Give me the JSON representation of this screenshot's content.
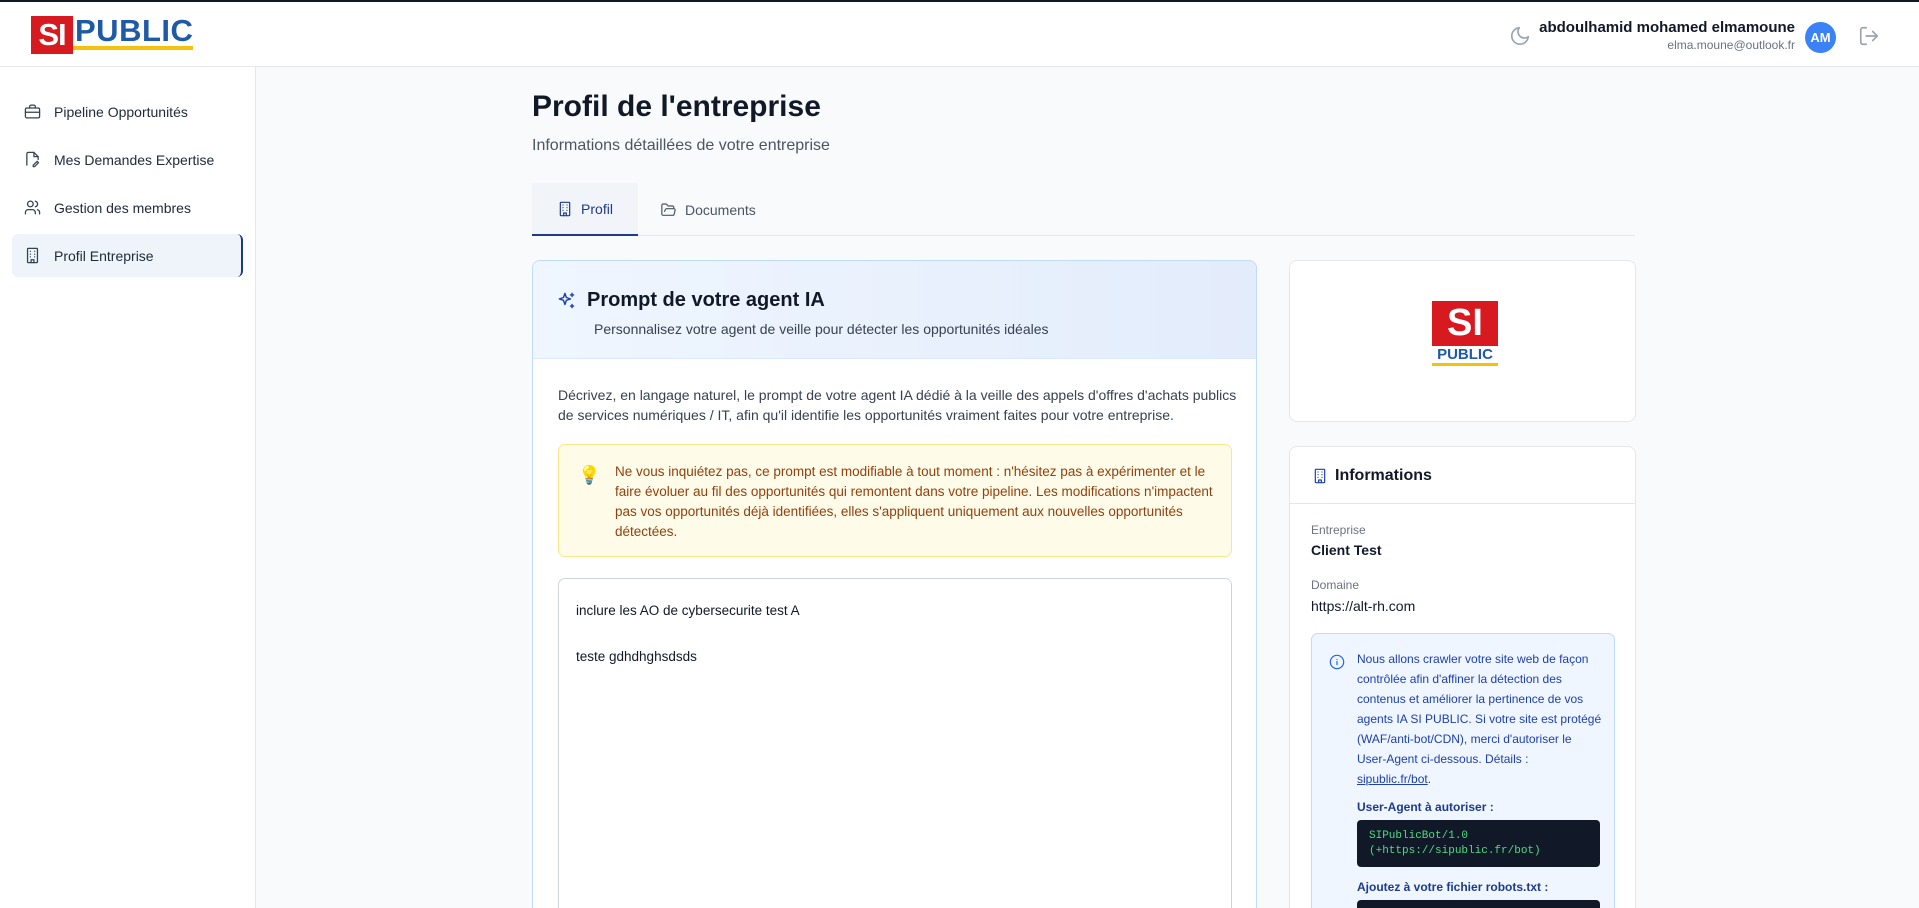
{
  "header": {
    "logo_si": "SI",
    "logo_public": "PUBLIC",
    "user_name": "abdoulhamid mohamed elmamoune",
    "user_email": "elma.moune@outlook.fr",
    "avatar_initials": "AM",
    "icons": [
      "moon-icon",
      "logout-icon"
    ]
  },
  "sidebar": {
    "items": [
      {
        "label": "Pipeline Opportunités",
        "icon": "briefcase-icon",
        "active": false
      },
      {
        "label": "Mes Demandes Expertise",
        "icon": "file-edit-icon",
        "active": false
      },
      {
        "label": "Gestion des membres",
        "icon": "users-icon",
        "active": false
      },
      {
        "label": "Profil Entreprise",
        "icon": "building-icon",
        "active": true
      }
    ]
  },
  "page": {
    "title": "Profil de l'entreprise",
    "subtitle": "Informations détaillées de votre entreprise"
  },
  "tabs": [
    {
      "label": "Profil",
      "icon": "building-icon",
      "active": true
    },
    {
      "label": "Documents",
      "icon": "folder-open-icon",
      "active": false
    }
  ],
  "prompt": {
    "title": "Prompt de votre agent IA",
    "subtitle": "Personnalisez votre agent de veille pour détecter les opportunités idéales",
    "description": "Décrivez, en langage naturel, le prompt de votre agent IA dédié à la veille des appels d'offres d'achats publics de services numériques / IT, afin qu'il identifie les opportunités vraiment faites pour votre entreprise.",
    "tip": "Ne vous inquiétez pas, ce prompt est modifiable à tout moment : n'hésitez pas à expérimenter et le faire évoluer au fil des opportunités qui remontent dans votre pipeline. Les modifications n'impactent pas vos opportunités déjà identifiées, elles s'appliquent uniquement aux nouvelles opportunités détectées.",
    "value": "inclure les AO de cybersecurite test A\n\nteste gdhdhghsdsds"
  },
  "company_logo": {
    "si": "SI",
    "public": "PUBLIC"
  },
  "info": {
    "title": "Informations",
    "entreprise_label": "Entreprise",
    "entreprise_value": "Client Test",
    "domaine_label": "Domaine",
    "domaine_value": "https://alt-rh.com",
    "crawl_text": "Nous allons crawler votre site web de façon contrôlée afin d'affiner la détection des contenus et améliorer la pertinence de vos agents IA SI PUBLIC. Si votre site est protégé (WAF/anti-bot/CDN), merci d'autoriser le User-Agent ci-dessous. Détails : ",
    "crawl_link": "sipublic.fr/bot",
    "crawl_end": ".",
    "ua_label": "User-Agent à autoriser :",
    "ua_value": "SIPublicBot/1.0\n(+https://sipublic.fr/bot)",
    "robots_label": "Ajoutez à votre fichier robots.txt :"
  },
  "colors": {
    "brand_red": "#d71920",
    "brand_blue": "#1f5aa6",
    "brand_yellow": "#f4c20d",
    "accent": "#1e3a8a",
    "avatar": "#3b82f6"
  }
}
